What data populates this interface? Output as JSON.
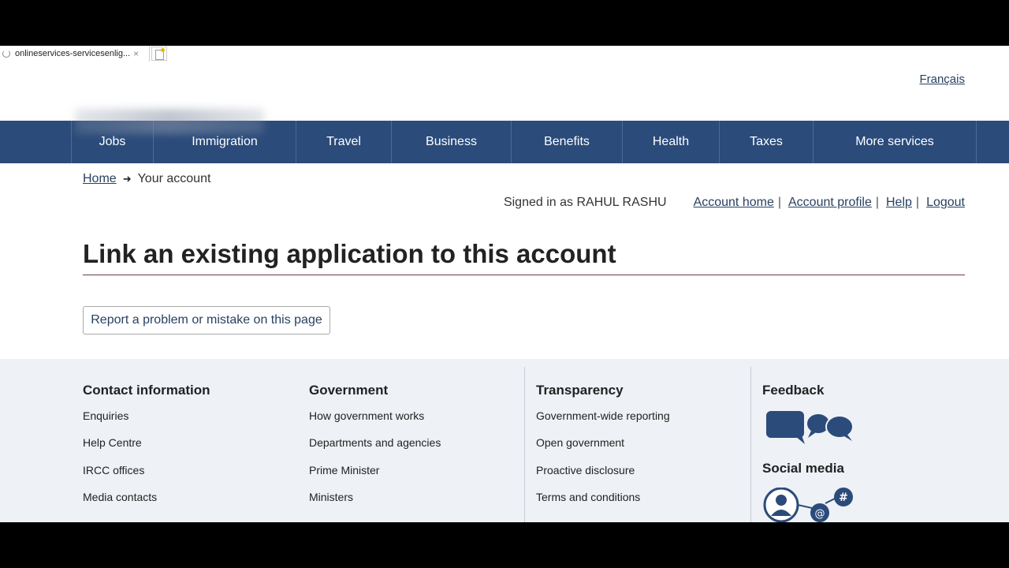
{
  "browser": {
    "tab_title": "onlineservices-servicesenlig...",
    "tab_close": "×"
  },
  "header": {
    "language_link": "Français"
  },
  "menu": {
    "items": [
      {
        "label": "Jobs"
      },
      {
        "label": "Immigration"
      },
      {
        "label": "Travel"
      },
      {
        "label": "Business"
      },
      {
        "label": "Benefits"
      },
      {
        "label": "Health"
      },
      {
        "label": "Taxes"
      },
      {
        "label": "More services"
      }
    ]
  },
  "breadcrumb": {
    "home": "Home",
    "current": "Your account"
  },
  "account": {
    "signed_in": "Signed in as RAHUL RASHU",
    "account_home": "Account home",
    "account_profile": "Account profile",
    "help": "Help",
    "logout": "Logout",
    "separator": "|"
  },
  "main": {
    "title": "Link an existing application to this account",
    "report_button": "Report a problem or mistake on this page"
  },
  "footer": {
    "contact": {
      "heading": "Contact information",
      "links": [
        "Enquiries",
        "Help Centre",
        "IRCC offices",
        "Media contacts"
      ]
    },
    "government": {
      "heading": "Government",
      "links": [
        "How government works",
        "Departments and agencies",
        "Prime Minister",
        "Ministers"
      ]
    },
    "transparency": {
      "heading": "Transparency",
      "links": [
        "Government-wide reporting",
        "Open government",
        "Proactive disclosure",
        "Terms and conditions"
      ]
    },
    "feedback": {
      "heading": "Feedback"
    },
    "social": {
      "heading": "Social media"
    }
  },
  "colors": {
    "menu_bg": "#2b4b7a",
    "link": "#284162",
    "footer_bg": "#eef1f6",
    "icon": "#2b4b7a"
  }
}
